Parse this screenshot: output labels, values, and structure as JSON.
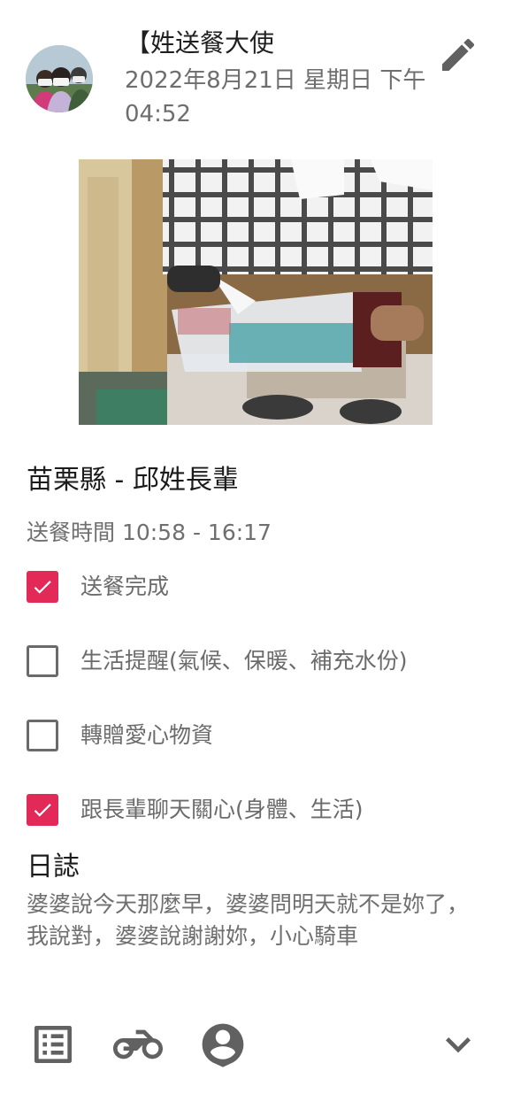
{
  "post": {
    "author": "【姓送餐大使",
    "timestamp": "2022年8月21日 星期日 下午04:52"
  },
  "recipient": "苗栗縣 - 邱姓長輩",
  "delivery_time": "送餐時間 10:58 - 16:17",
  "checklist": [
    {
      "label": "送餐完成",
      "checked": true
    },
    {
      "label": "生活提醒(氣候、保暖、補充水份)",
      "checked": false
    },
    {
      "label": "轉贈愛心物資",
      "checked": false
    },
    {
      "label": "跟長輩聊天關心(身體、生活)",
      "checked": true
    }
  ],
  "log": {
    "title": "日誌",
    "text": "婆婆說今天那麼早，婆婆問明天就不是妳了，我說對，婆婆說謝謝妳，小心騎車"
  },
  "colors": {
    "accent": "#e32958",
    "icon_gray": "#616161",
    "text_gray": "#6f6f6f"
  },
  "icons": {
    "edit": "pencil-icon",
    "list": "list-icon",
    "bike": "motorcycle-icon",
    "location": "person-pin-icon",
    "expand": "chevron-down-icon"
  }
}
